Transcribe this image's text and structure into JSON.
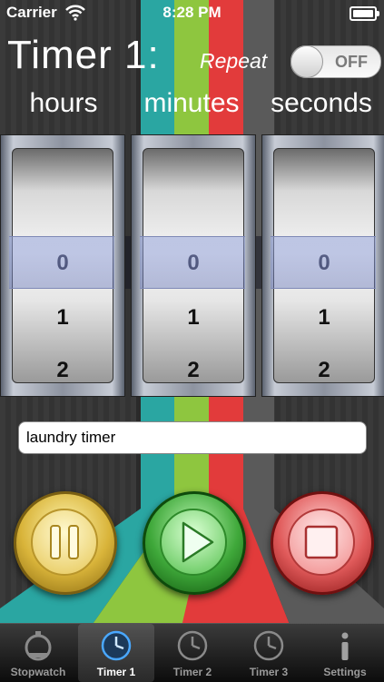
{
  "status_bar": {
    "carrier": "Carrier",
    "time": "8:28 PM",
    "wifi_icon": "wifi-icon",
    "battery_icon": "battery-icon"
  },
  "header": {
    "title": "Timer 1:",
    "repeat_label": "Repeat",
    "repeat_toggle": "OFF"
  },
  "units": {
    "hours": "hours",
    "minutes": "minutes",
    "seconds": "seconds"
  },
  "pickers": {
    "hours": {
      "selected": "0",
      "next": [
        "1",
        "2"
      ]
    },
    "minutes": {
      "selected": "0",
      "next": [
        "1",
        "2"
      ]
    },
    "seconds": {
      "selected": "0",
      "next": [
        "1",
        "2"
      ]
    }
  },
  "label_field": {
    "value": "laundry timer"
  },
  "controls": {
    "pause_icon": "pause-icon",
    "play_icon": "play-icon",
    "stop_icon": "stop-icon"
  },
  "tabs": [
    {
      "label": "Stopwatch",
      "icon": "stopwatch-icon"
    },
    {
      "label": "Timer 1",
      "icon": "clock-icon",
      "active": true
    },
    {
      "label": "Timer 2",
      "icon": "clock-icon"
    },
    {
      "label": "Timer 3",
      "icon": "clock-icon"
    },
    {
      "label": "Settings",
      "icon": "info-icon"
    }
  ],
  "colors": {
    "teal": "#2aa6a2",
    "green": "#8ec63f",
    "red": "#e23b3b"
  }
}
